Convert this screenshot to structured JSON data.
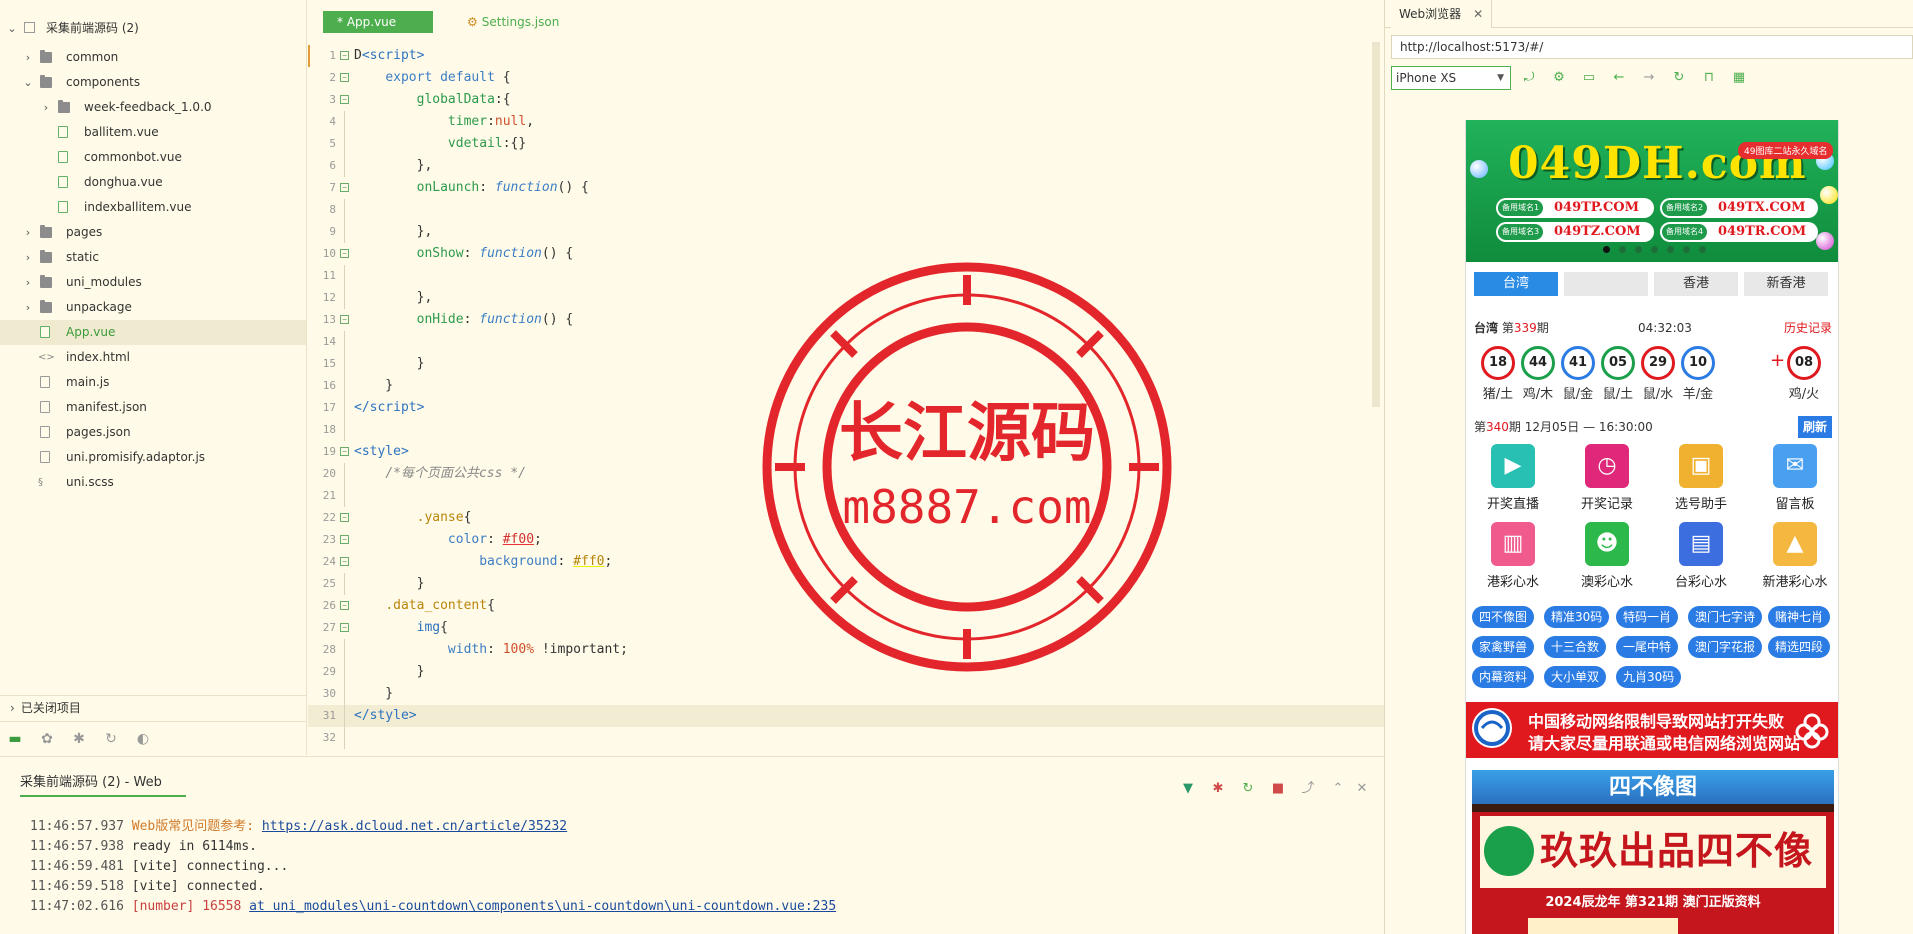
{
  "explorer": {
    "project": "采集前端源码 (2)",
    "items": [
      {
        "label": "common",
        "type": "folder",
        "depth": 1,
        "expanded": false
      },
      {
        "label": "components",
        "type": "folder",
        "depth": 1,
        "expanded": true
      },
      {
        "label": "week-feedback_1.0.0",
        "type": "folder",
        "depth": 2,
        "expanded": false
      },
      {
        "label": "ballitem.vue",
        "type": "vue",
        "depth": 2
      },
      {
        "label": "commonbot.vue",
        "type": "vue",
        "depth": 2
      },
      {
        "label": "donghua.vue",
        "type": "vue",
        "depth": 2
      },
      {
        "label": "indexballitem.vue",
        "type": "vue",
        "depth": 2
      },
      {
        "label": "pages",
        "type": "folder",
        "depth": 1,
        "expanded": false
      },
      {
        "label": "static",
        "type": "folder",
        "depth": 1,
        "expanded": false
      },
      {
        "label": "uni_modules",
        "type": "folder",
        "depth": 1,
        "expanded": false
      },
      {
        "label": "unpackage",
        "type": "folder",
        "depth": 1,
        "expanded": false
      },
      {
        "label": "App.vue",
        "type": "vue",
        "depth": 1,
        "selected": true
      },
      {
        "label": "index.html",
        "type": "html",
        "depth": 1
      },
      {
        "label": "main.js",
        "type": "js",
        "depth": 1
      },
      {
        "label": "manifest.json",
        "type": "json",
        "depth": 1
      },
      {
        "label": "pages.json",
        "type": "json",
        "depth": 1
      },
      {
        "label": "uni.promisify.adaptor.js",
        "type": "js",
        "depth": 1
      },
      {
        "label": "uni.scss",
        "type": "scss",
        "depth": 1
      }
    ],
    "closed_projects": "已关闭项目"
  },
  "editor": {
    "tabs": [
      {
        "label": "* App.vue",
        "active": true
      },
      {
        "label": "Settings.json",
        "active": false
      }
    ],
    "current_line": 31,
    "lines": [
      {
        "n": "1",
        "fold": true,
        "html": "D<span class=\"tag-c\">&lt;script&gt;</span>"
      },
      {
        "n": "2",
        "fold": true,
        "html": "    <span class=\"k\">export</span> <span class=\"k\">default</span> {"
      },
      {
        "n": "3",
        "fold": true,
        "html": "        <span class=\"prop\">globalData</span>:{"
      },
      {
        "n": "4",
        "html": "            <span class=\"prop\">timer</span>:<span class=\"nul\">null</span>,"
      },
      {
        "n": "5",
        "html": "            <span class=\"prop\">vdetail</span>:{}"
      },
      {
        "n": "6",
        "html": "        },"
      },
      {
        "n": "7",
        "fold": true,
        "html": "        <span class=\"prop\">onLaunch</span>: <span class=\"fn\">function</span>() {"
      },
      {
        "n": "8",
        "html": ""
      },
      {
        "n": "9",
        "html": "        },"
      },
      {
        "n": "10",
        "fold": true,
        "html": "        <span class=\"prop\">onShow</span>: <span class=\"fn\">function</span>() {"
      },
      {
        "n": "11",
        "html": ""
      },
      {
        "n": "12",
        "html": "        },"
      },
      {
        "n": "13",
        "fold": true,
        "html": "        <span class=\"prop\">onHide</span>: <span class=\"fn\">function</span>() {"
      },
      {
        "n": "14",
        "html": ""
      },
      {
        "n": "15",
        "html": "        }"
      },
      {
        "n": "16",
        "html": "    }"
      },
      {
        "n": "17",
        "html": "<span class=\"tag-c\">&lt;/script&gt;</span>"
      },
      {
        "n": "18",
        "html": ""
      },
      {
        "n": "19",
        "fold": true,
        "html": "<span class=\"tag-c\">&lt;style&gt;</span>"
      },
      {
        "n": "20",
        "html": "    <span class=\"cm\">/*每个页面公共css */</span>"
      },
      {
        "n": "21",
        "html": ""
      },
      {
        "n": "22",
        "fold": true,
        "html": "        <span class=\"sel\">.yanse</span>{"
      },
      {
        "n": "23",
        "fold": true,
        "html": "            <span class=\"k\">color</span>: <span class=\"hexred\">#f00</span>;"
      },
      {
        "n": "24",
        "fold": true,
        "html": "                <span class=\"k\">background</span>: <span class=\"hexyel\">#ff0</span>;"
      },
      {
        "n": "25",
        "html": "        }"
      },
      {
        "n": "26",
        "fold": true,
        "html": "    <span class=\"sel\">.data_content</span>{"
      },
      {
        "n": "27",
        "fold": true,
        "html": "        <span class=\"tag-c\">img</span>{"
      },
      {
        "n": "28",
        "html": "            <span class=\"k\">width</span>: <span class=\"pct\">100%</span> !important;"
      },
      {
        "n": "29",
        "html": "        }"
      },
      {
        "n": "30",
        "html": "    }"
      },
      {
        "n": "31",
        "html": "<span class=\"tag-c\">&lt;/style&gt;</span>"
      },
      {
        "n": "32",
        "html": ""
      }
    ]
  },
  "watermark": {
    "line1": "长江源码",
    "line2": "m8887.com"
  },
  "console": {
    "tab": "采集前端源码 (2) - Web",
    "logs": [
      {
        "ts": "11:46:57.937",
        "prefix": "Web版常见问题参考: ",
        "prefix_class": "orange",
        "link": "https://ask.dcloud.net.cn/article/35232",
        "rest": ""
      },
      {
        "ts": "11:46:57.938",
        "prefix": "",
        "prefix_class": "",
        "link": "",
        "rest": "  ready in 6114ms."
      },
      {
        "ts": "11:46:59.481",
        "prefix": "",
        "prefix_class": "",
        "link": "",
        "rest": "[vite] connecting..."
      },
      {
        "ts": "11:46:59.518",
        "prefix": "",
        "prefix_class": "",
        "link": "",
        "rest": "[vite] connected."
      },
      {
        "ts": "11:47:02.616",
        "prefix": "[number] 16558 ",
        "prefix_class": "red",
        "link": "at uni_modules\\uni-countdown\\components\\uni-countdown\\uni-countdown.vue:235",
        "rest": ""
      }
    ]
  },
  "browser": {
    "tab": "Web浏览器",
    "url": "http://localhost:5173/#/",
    "device": "iPhone XS"
  },
  "phone": {
    "banner": {
      "domain_main": "049DH",
      "domain_suffix": ".com",
      "badge": "49图库二站永久域名",
      "domains": [
        {
          "key": "备用域名1",
          "val": "049TP.COM"
        },
        {
          "key": "备用域名2",
          "val": "049TX.COM"
        },
        {
          "key": "备用域名3",
          "val": "049TZ.COM"
        },
        {
          "key": "备用域名4",
          "val": "049TR.COM"
        }
      ]
    },
    "regions": [
      {
        "label": "台湾",
        "on": true
      },
      {
        "label": "",
        "on": false
      },
      {
        "label": "香港",
        "on": false
      },
      {
        "label": "新香港",
        "on": false
      }
    ],
    "draw": {
      "region": "台湾",
      "prefix": " 第",
      "issue": "339",
      "suffix": "期",
      "countdown": "04:32:03",
      "history": "历史记录"
    },
    "balls": [
      {
        "num": "18",
        "zodiac": "猪/土",
        "color": "red"
      },
      {
        "num": "44",
        "zodiac": "鸡/木",
        "color": "green"
      },
      {
        "num": "41",
        "zodiac": "鼠/金",
        "color": "blue"
      },
      {
        "num": "05",
        "zodiac": "鼠/土",
        "color": "green"
      },
      {
        "num": "29",
        "zodiac": "鼠/水",
        "color": "red"
      },
      {
        "num": "10",
        "zodiac": "羊/金",
        "color": "blue"
      },
      {
        "num": "08",
        "zodiac": "鸡/火",
        "color": "red"
      }
    ],
    "plus": "+",
    "next": {
      "prefix": "第",
      "issue": "340",
      "rest": "期 12月05日 — 16:30:00",
      "refresh": "刷新"
    },
    "grid": [
      {
        "label": "开奖直播",
        "color": "#29c0b4",
        "glyph": "▶"
      },
      {
        "label": "开奖记录",
        "color": "#e0287a",
        "glyph": "◷"
      },
      {
        "label": "选号助手",
        "color": "#f0b030",
        "glyph": "▣"
      },
      {
        "label": "留言板",
        "color": "#4aa0f0",
        "glyph": "✉"
      },
      {
        "label": "港彩心水",
        "color": "#f05a8c",
        "glyph": "▥"
      },
      {
        "label": "澳彩心水",
        "color": "#2cb84a",
        "glyph": "☻"
      },
      {
        "label": "台彩心水",
        "color": "#3c6ee0",
        "glyph": "▤"
      },
      {
        "label": "新港彩心水",
        "color": "#f4b840",
        "glyph": "▲"
      }
    ],
    "chips": [
      "四不像图",
      "精准30码",
      "特码一肖",
      "澳门七字诗",
      "赌神七肖",
      "家禽野兽",
      "十三合数",
      "一尾中特",
      "澳门字花报",
      "精选四段",
      "内幕资料",
      "大小单双",
      "九肖30码"
    ],
    "notice": {
      "line1": "中国移动网络限制导致网站打开失败",
      "line2": "请大家尽量用联通或电信网络浏览网站"
    },
    "poster": {
      "title": "四不像图",
      "main": "玖玖出品四不像",
      "sub": "2024辰龙年  第321期  澳门正版资料"
    }
  },
  "colors": {
    "accent": "#4cae4c",
    "bg": "#fffbe8",
    "watermark": "#e3262b"
  }
}
